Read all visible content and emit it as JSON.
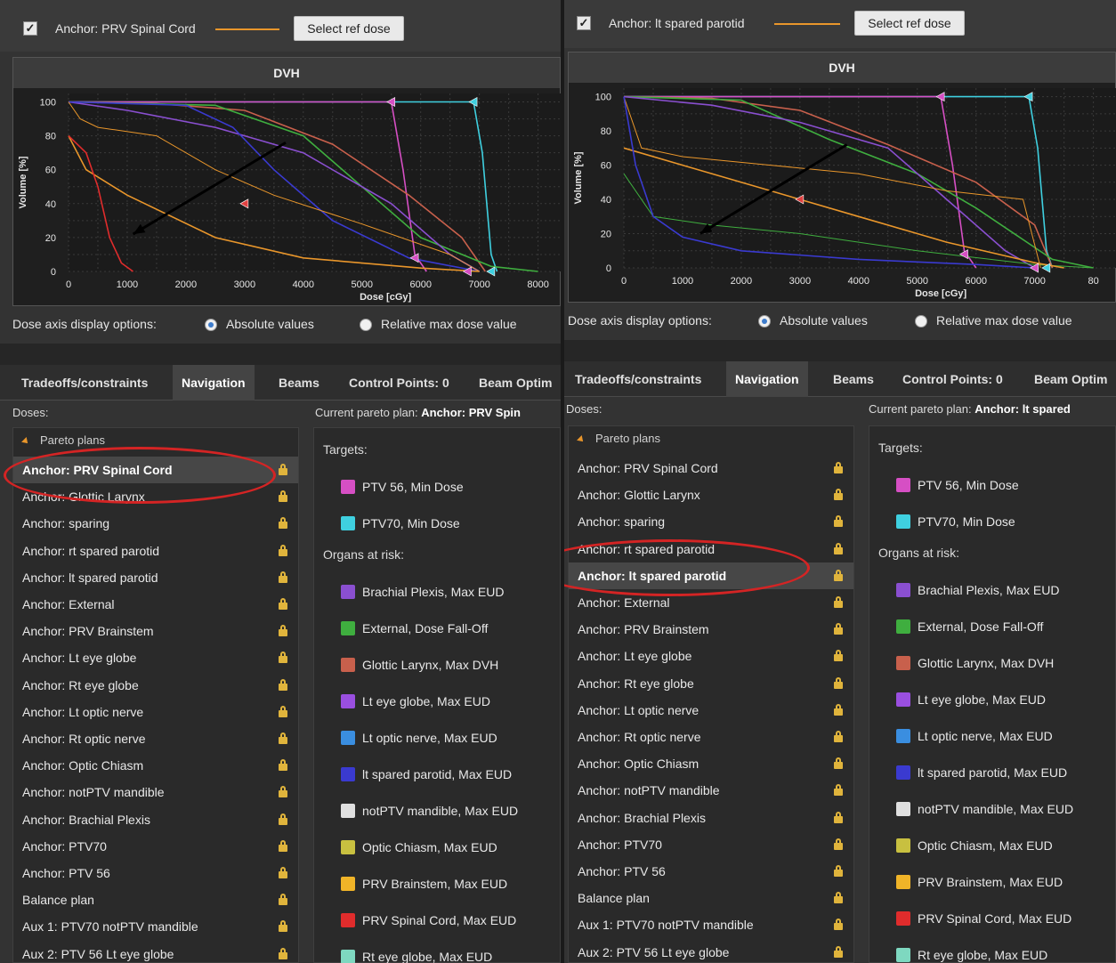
{
  "left": {
    "anchor_label": "Anchor: PRV Spinal Cord",
    "ref_dose_button": "Select ref dose",
    "dvh_title": "DVH",
    "y_axis_label": "Volume [%]",
    "x_axis_label": "Dose [cGy]",
    "y_ticks": [
      "100",
      "80",
      "60",
      "40",
      "20",
      "0"
    ],
    "x_ticks": [
      "0",
      "1000",
      "2000",
      "3000",
      "4000",
      "5000",
      "6000",
      "7000",
      "8000"
    ],
    "dose_axis_options_label": "Dose axis display options:",
    "option_absolute": "Absolute values",
    "option_relative": "Relative max dose value",
    "tabs": [
      "Tradeoffs/constraints",
      "Navigation",
      "Beams",
      "Control Points: 0",
      "Beam Optim"
    ],
    "doses_label": "Doses:",
    "current_plan_prefix": "Current pareto plan:",
    "current_plan_value": "Anchor: PRV Spin",
    "pareto_header": "Pareto plans",
    "doses": [
      "Anchor: PRV Spinal Cord",
      "Anchor: Glottic Larynx",
      "Anchor: sparing",
      "Anchor: rt spared parotid",
      "Anchor: lt spared parotid",
      "Anchor: External",
      "Anchor: PRV Brainstem",
      "Anchor: Lt eye globe",
      "Anchor: Rt eye globe",
      "Anchor: Lt optic nerve",
      "Anchor: Rt optic nerve",
      "Anchor: Optic Chiasm",
      "Anchor: notPTV mandible",
      "Anchor: Brachial Plexis",
      "Anchor: PTV70",
      "Anchor: PTV 56",
      "Balance plan",
      "Aux 1: PTV70 notPTV mandible",
      "Aux 2: PTV 56 Lt eye globe"
    ],
    "selected_index": 0
  },
  "right": {
    "anchor_label": "Anchor: lt spared parotid",
    "ref_dose_button": "Select ref dose",
    "dvh_title": "DVH",
    "y_axis_label": "Volume [%]",
    "x_axis_label": "Dose [cGy]",
    "y_ticks": [
      "100",
      "80",
      "60",
      "40",
      "20",
      "0"
    ],
    "x_ticks": [
      "0",
      "1000",
      "2000",
      "3000",
      "4000",
      "5000",
      "6000",
      "7000",
      "80"
    ],
    "dose_axis_options_label": "Dose axis display options:",
    "option_absolute": "Absolute values",
    "option_relative": "Relative max dose value",
    "tabs": [
      "Tradeoffs/constraints",
      "Navigation",
      "Beams",
      "Control Points: 0",
      "Beam Optim"
    ],
    "doses_label": "Doses:",
    "current_plan_prefix": "Current pareto plan:",
    "current_plan_value": "Anchor: lt spared",
    "pareto_header": "Pareto plans",
    "doses": [
      "Anchor: PRV Spinal Cord",
      "Anchor: Glottic Larynx",
      "Anchor: sparing",
      "Anchor: rt spared parotid",
      "Anchor: lt spared parotid",
      "Anchor: External",
      "Anchor: PRV Brainstem",
      "Anchor: Lt eye globe",
      "Anchor: Rt eye globe",
      "Anchor: Lt optic nerve",
      "Anchor: Rt optic nerve",
      "Anchor: Optic Chiasm",
      "Anchor: notPTV mandible",
      "Anchor: Brachial Plexis",
      "Anchor: PTV70",
      "Anchor: PTV 56",
      "Balance plan",
      "Aux 1: PTV70 notPTV mandible",
      "Aux 2: PTV 56 Lt eye globe"
    ],
    "selected_index": 4
  },
  "targets_label": "Targets:",
  "organs_label": "Organs at risk:",
  "targets": [
    {
      "label": "PTV 56, Min Dose",
      "color": "#d64fc4"
    },
    {
      "label": "PTV70, Min Dose",
      "color": "#3fd0e0"
    }
  ],
  "organs": [
    {
      "label": "Brachial Plexis, Max EUD",
      "color": "#8a4fd0"
    },
    {
      "label": "External, Dose Fall-Off",
      "color": "#3fae3f"
    },
    {
      "label": "Glottic Larynx, Max DVH",
      "color": "#c8604c"
    },
    {
      "label": "Lt eye globe, Max EUD",
      "color": "#9a4fe0"
    },
    {
      "label": "Lt optic nerve, Max EUD",
      "color": "#3a8ee0"
    },
    {
      "label": "lt spared parotid, Max EUD",
      "color": "#3a3ad0"
    },
    {
      "label": "notPTV mandible, Max EUD",
      "color": "#e0e0e0"
    },
    {
      "label": "Optic Chiasm, Max EUD",
      "color": "#c8c040"
    },
    {
      "label": "PRV Brainstem, Max EUD",
      "color": "#f0b428"
    },
    {
      "label": "PRV Spinal Cord, Max EUD",
      "color": "#e02c2c"
    },
    {
      "label": "Rt eye globe, Max EUD",
      "color": "#7ed8c0"
    }
  ]
}
